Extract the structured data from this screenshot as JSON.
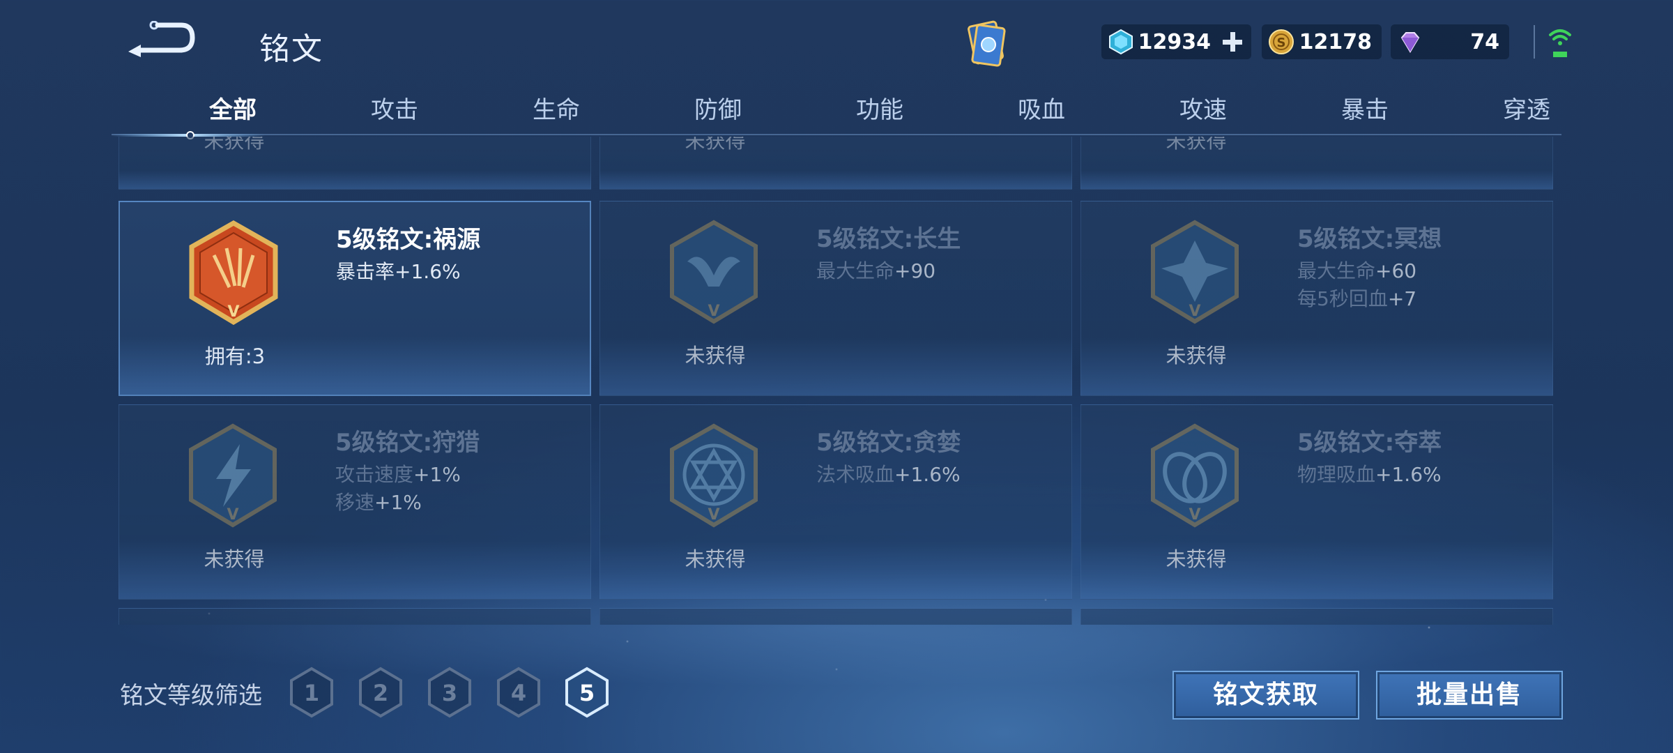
{
  "header": {
    "title": "铭文",
    "currencies": {
      "coupon": "12934",
      "coin": "12178",
      "gem": "74"
    }
  },
  "tabs": [
    "全部",
    "攻击",
    "生命",
    "防御",
    "功能",
    "吸血",
    "攻速",
    "暴击",
    "穿透"
  ],
  "active_tab": "全部",
  "grid": {
    "top_row_status": [
      "未获得",
      "未获得",
      "未获得"
    ],
    "items": [
      {
        "name": "5级铭文:祸源",
        "attrs": [
          {
            "label": "暴击率",
            "value": "+1.6%"
          }
        ],
        "status": "拥有:3",
        "owned": true,
        "emblem": "red-card-emblem-icon"
      },
      {
        "name": "5级铭文:长生",
        "attrs": [
          {
            "label": "最大生命",
            "value": "+90"
          }
        ],
        "status": "未获得",
        "owned": false,
        "emblem": "whale-tail-emblem-icon"
      },
      {
        "name": "5级铭文:冥想",
        "attrs": [
          {
            "label": "最大生命",
            "value": "+60"
          },
          {
            "label": "每5秒回血",
            "value": "+7"
          }
        ],
        "status": "未获得",
        "owned": false,
        "emblem": "meditation-emblem-icon"
      },
      {
        "name": "5级铭文:狩猎",
        "attrs": [
          {
            "label": "攻击速度",
            "value": "+1%"
          },
          {
            "label": "移速",
            "value": "+1%"
          }
        ],
        "status": "未获得",
        "owned": false,
        "emblem": "lightning-emblem-icon"
      },
      {
        "name": "5级铭文:贪婪",
        "attrs": [
          {
            "label": "法术吸血",
            "value": "+1.6%"
          }
        ],
        "status": "未获得",
        "owned": false,
        "emblem": "hexagram-emblem-icon"
      },
      {
        "name": "5级铭文:夺萃",
        "attrs": [
          {
            "label": "物理吸血",
            "value": "+1.6%"
          }
        ],
        "status": "未获得",
        "owned": false,
        "emblem": "knot-emblem-icon"
      }
    ]
  },
  "filter": {
    "label": "铭文等级筛选",
    "levels": [
      "1",
      "2",
      "3",
      "4",
      "5"
    ],
    "selected": "5"
  },
  "buttons": {
    "get": "铭文获取",
    "sell": "批量出售"
  },
  "colors": {
    "accent": "#3f74b8",
    "owned_emblem": "#c8481f",
    "gold": "#d8a84a"
  }
}
